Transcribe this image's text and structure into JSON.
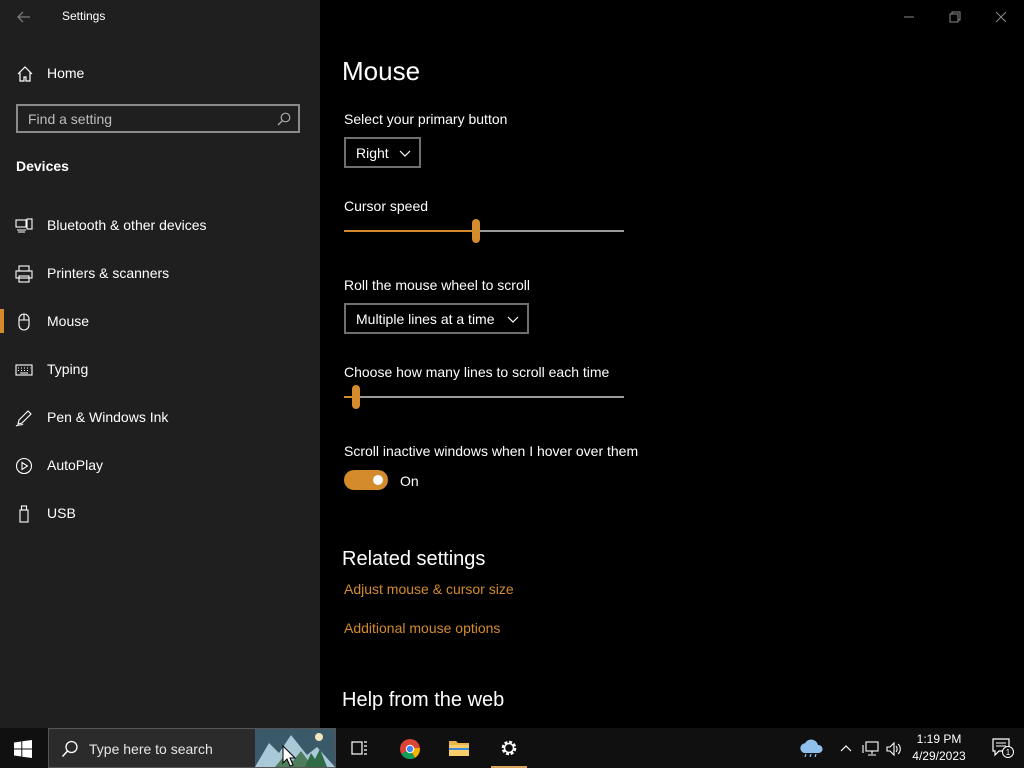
{
  "app": {
    "title": "Settings"
  },
  "sidebar": {
    "home_label": "Home",
    "search_placeholder": "Find a setting",
    "section_title": "Devices",
    "items": [
      {
        "label": "Bluetooth & other devices",
        "icon": "bluetooth-devices-icon"
      },
      {
        "label": "Printers & scanners",
        "icon": "printer-icon"
      },
      {
        "label": "Mouse",
        "icon": "mouse-icon",
        "active": true
      },
      {
        "label": "Typing",
        "icon": "keyboard-icon"
      },
      {
        "label": "Pen & Windows Ink",
        "icon": "pen-icon"
      },
      {
        "label": "AutoPlay",
        "icon": "autoplay-icon"
      },
      {
        "label": "USB",
        "icon": "usb-icon"
      }
    ]
  },
  "main": {
    "title": "Mouse",
    "primary_button": {
      "label": "Select your primary button",
      "value": "Right"
    },
    "cursor_speed": {
      "label": "Cursor speed",
      "level": 0.47
    },
    "wheel_scroll": {
      "label": "Roll the mouse wheel to scroll",
      "value": "Multiple lines at a time"
    },
    "lines_to_scroll": {
      "label": "Choose how many lines to scroll each time",
      "level": 0.03
    },
    "inactive_scroll": {
      "label": "Scroll inactive windows when I hover over them",
      "state": "On"
    },
    "related": {
      "heading": "Related settings",
      "links": [
        "Adjust mouse & cursor size",
        "Additional mouse options"
      ]
    },
    "help_heading": "Help from the web"
  },
  "taskbar": {
    "search_text": "Type here to search",
    "clock_time": "1:19 PM",
    "clock_date": "4/29/2023",
    "notification_count": "1"
  },
  "colors": {
    "accent": "#d38b2c",
    "sidebar_bg": "#1f1f1f",
    "main_bg": "#000000"
  }
}
